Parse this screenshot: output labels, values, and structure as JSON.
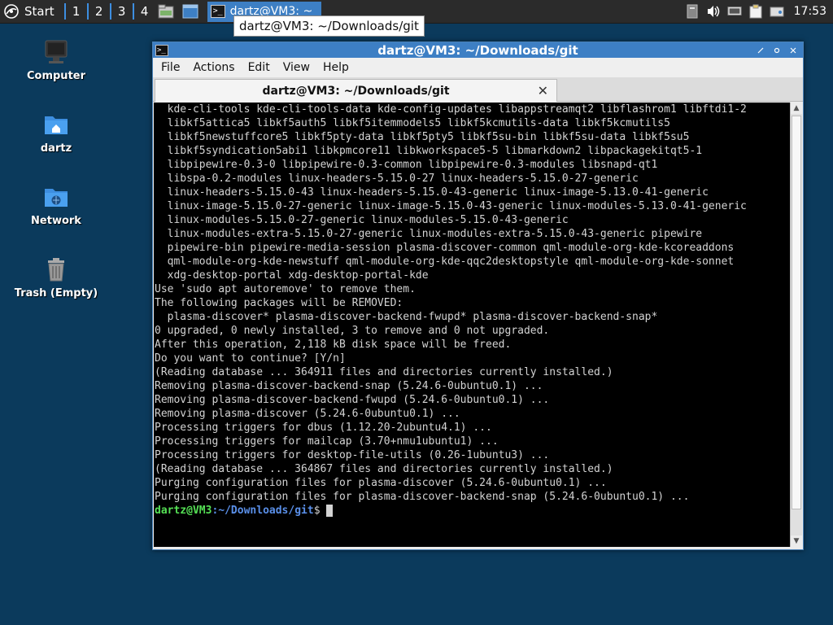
{
  "taskbar": {
    "start_label": "Start",
    "workspaces": [
      "1",
      "2",
      "3",
      "4"
    ],
    "task_title": "dartz@VM3: ~",
    "clock": "17:53"
  },
  "tooltip": "dartz@VM3: ~/Downloads/git",
  "desktop": {
    "icons": [
      "Computer",
      "dartz",
      "Network",
      "Trash (Empty)"
    ]
  },
  "window": {
    "title": "dartz@VM3: ~/Downloads/git",
    "menu": [
      "File",
      "Actions",
      "Edit",
      "View",
      "Help"
    ],
    "tab_title": "dartz@VM3: ~/Downloads/git",
    "prompt": {
      "user_host": "dartz@VM3",
      "sep": ":",
      "path": "~/Downloads/git",
      "symbol": "$ "
    },
    "lines": [
      "  kde-cli-tools kde-cli-tools-data kde-config-updates libappstreamqt2 libflashrom1 libftdi1-2",
      "  libkf5attica5 libkf5auth5 libkf5itemmodels5 libkf5kcmutils-data libkf5kcmutils5",
      "  libkf5newstuffcore5 libkf5pty-data libkf5pty5 libkf5su-bin libkf5su-data libkf5su5",
      "  libkf5syndication5abi1 libkpmcore11 libkworkspace5-5 libmarkdown2 libpackagekitqt5-1",
      "  libpipewire-0.3-0 libpipewire-0.3-common libpipewire-0.3-modules libsnapd-qt1",
      "  libspa-0.2-modules linux-headers-5.15.0-27 linux-headers-5.15.0-27-generic",
      "  linux-headers-5.15.0-43 linux-headers-5.15.0-43-generic linux-image-5.13.0-41-generic",
      "  linux-image-5.15.0-27-generic linux-image-5.15.0-43-generic linux-modules-5.13.0-41-generic",
      "  linux-modules-5.15.0-27-generic linux-modules-5.15.0-43-generic",
      "  linux-modules-extra-5.15.0-27-generic linux-modules-extra-5.15.0-43-generic pipewire",
      "  pipewire-bin pipewire-media-session plasma-discover-common qml-module-org-kde-kcoreaddons",
      "  qml-module-org-kde-newstuff qml-module-org-kde-qqc2desktopstyle qml-module-org-kde-sonnet",
      "  xdg-desktop-portal xdg-desktop-portal-kde",
      "Use 'sudo apt autoremove' to remove them.",
      "The following packages will be REMOVED:",
      "  plasma-discover* plasma-discover-backend-fwupd* plasma-discover-backend-snap*",
      "0 upgraded, 0 newly installed, 3 to remove and 0 not upgraded.",
      "After this operation, 2,118 kB disk space will be freed.",
      "Do you want to continue? [Y/n]",
      "(Reading database ... 364911 files and directories currently installed.)",
      "Removing plasma-discover-backend-snap (5.24.6-0ubuntu0.1) ...",
      "Removing plasma-discover-backend-fwupd (5.24.6-0ubuntu0.1) ...",
      "Removing plasma-discover (5.24.6-0ubuntu0.1) ...",
      "Processing triggers for dbus (1.12.20-2ubuntu4.1) ...",
      "Processing triggers for mailcap (3.70+nmu1ubuntu1) ...",
      "Processing triggers for desktop-file-utils (0.26-1ubuntu3) ...",
      "(Reading database ... 364867 files and directories currently installed.)",
      "Purging configuration files for plasma-discover (5.24.6-0ubuntu0.1) ...",
      "Purging configuration files for plasma-discover-backend-snap (5.24.6-0ubuntu0.1) ..."
    ]
  },
  "colors": {
    "desktop_bg": "#0b3a5c",
    "accent": "#3d7fc4",
    "prompt_user": "#55e055",
    "prompt_path": "#5a8fe8",
    "terminal_fg": "#d3d3d3",
    "terminal_bg": "#000000"
  }
}
